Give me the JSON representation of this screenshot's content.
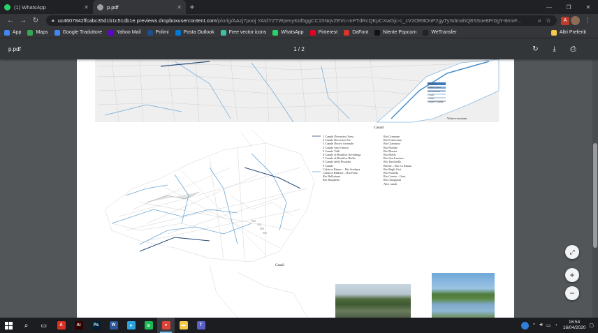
{
  "browser": {
    "tabs": [
      {
        "label": "(1) WhatsApp",
        "color": "#25d366",
        "active": false
      },
      {
        "label": "p.pdf",
        "color": "#9aa0a6",
        "active": true
      }
    ],
    "new_tab_symbol": "+",
    "url_host": "uc4607842ffcabc35d1b1c51db1e.previews.dropboxusercontent.com",
    "url_path": "/p/orig/AAzj7pooj YAIdYZTWpesyKtd5ggCC15NqvZEVc-mPTdRcQKpCXwGjc-c_zV2OR8OnP2gyTySdmahQ8SSoe8Fr0gY-8mvF..."
  },
  "bookmarks": [
    {
      "label": "App",
      "color": "#4285f4"
    },
    {
      "label": "Maps",
      "color": "#34a853"
    },
    {
      "label": "Google Traduttore",
      "color": "#4285f4"
    },
    {
      "label": "Yahoo Mail",
      "color": "#6001d2"
    },
    {
      "label": "Polimi",
      "color": "#1f4e8c"
    },
    {
      "label": "Posta Outlook",
      "color": "#0078d4"
    },
    {
      "label": "Free vector icons",
      "color": "#3ac1a5"
    },
    {
      "label": "WhatsApp",
      "color": "#25d366"
    },
    {
      "label": "Pinterest",
      "color": "#e60023"
    },
    {
      "label": "DaFont",
      "color": "#d9352b"
    },
    {
      "label": "Niente Popcorn",
      "color": "#111111"
    },
    {
      "label": "WeTransfer",
      "color": "#222222"
    }
  ],
  "bookmarks_other": "Altri Preferiti",
  "pdf": {
    "filename": "p.pdf",
    "page_indicator": "1 / 2"
  },
  "document": {
    "top_legend": [
      "Fiume Po",
      "Fiume Ticino",
      "Terreni bassi",
      "Canali",
      "Canali",
      "Canali e confini"
    ],
    "top_caption": "Watersreasteam",
    "canali_title": "Canali",
    "canali_left": [
      "1 Canale Diversivo Ovest",
      "2 Canale Diversivo Est",
      "3 Canale Nuovo Arsenale",
      "4 Canale San Vittorio",
      "5 Canale Valli",
      "6 Canale di Bonifica Arvedinga",
      "7 Canale di Bonifica Riello",
      "8 Canale della Fissarda",
      "9 Canale",
      "Colatore Rinero – Rio Sordana",
      "Colatore Riblone – Rio Fiato",
      "Rio Bellottone",
      "Rio Borghetto"
    ],
    "canali_right": [
      "Rio Cremone",
      "Rio Forbiciano",
      "Rio Giarraino",
      "Rio Parente",
      "Rio Riseira",
      "Rio Riello",
      "Rio San Lazzaro",
      "Rio Tanchiello",
      "Rirone – Rio La Rinata",
      "Rio Bagli Ossi",
      "Rio Pusterla",
      "Rio Cerera – Gera",
      "Rio Chiapponi",
      "Altri canali"
    ],
    "map_caption": "Canali"
  },
  "zoom": {
    "fit": "⤢",
    "in": "+",
    "out": "−"
  },
  "taskbar": {
    "apps": [
      {
        "name": "acrobat",
        "color": "#d93025",
        "glyph": "A"
      },
      {
        "name": "illustrator",
        "color": "#330000",
        "glyph": "Ai"
      },
      {
        "name": "photoshop",
        "color": "#001e36",
        "glyph": "Ps"
      },
      {
        "name": "word",
        "color": "#2b579a",
        "glyph": "W"
      },
      {
        "name": "telegram",
        "color": "#2aa3e0",
        "glyph": "➤"
      },
      {
        "name": "spotify",
        "color": "#1db954",
        "glyph": "≋"
      },
      {
        "name": "chrome",
        "color": "#db4437",
        "glyph": "●"
      },
      {
        "name": "explorer",
        "color": "#f2c94c",
        "glyph": "▬"
      },
      {
        "name": "teams",
        "color": "#5b5fc7",
        "glyph": "T"
      }
    ],
    "time": "16:54",
    "date": "16/04/2020"
  }
}
